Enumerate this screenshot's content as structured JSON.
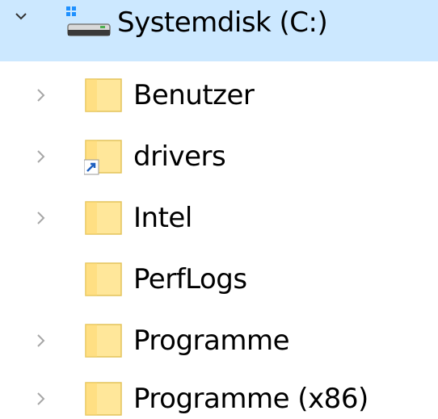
{
  "tree": {
    "drive": {
      "label": "Systemdisk (C:)",
      "expanded": true,
      "selected": true,
      "icon": "drive-icon"
    },
    "folders": [
      {
        "label": "Benutzer",
        "has_children": true,
        "shortcut": false
      },
      {
        "label": "drivers",
        "has_children": true,
        "shortcut": true
      },
      {
        "label": "Intel",
        "has_children": true,
        "shortcut": false
      },
      {
        "label": "PerfLogs",
        "has_children": false,
        "shortcut": false
      },
      {
        "label": "Programme",
        "has_children": true,
        "shortcut": false
      },
      {
        "label": "Programme (x86)",
        "has_children": true,
        "shortcut": false
      }
    ]
  },
  "colors": {
    "selection": "#cce8ff",
    "folder_fill": "#ffe79a",
    "folder_edge": "#e3c35a",
    "chevron": "#a6a6a6",
    "chevron_expanded": "#333333",
    "drive_accent": "#1e90ff"
  }
}
